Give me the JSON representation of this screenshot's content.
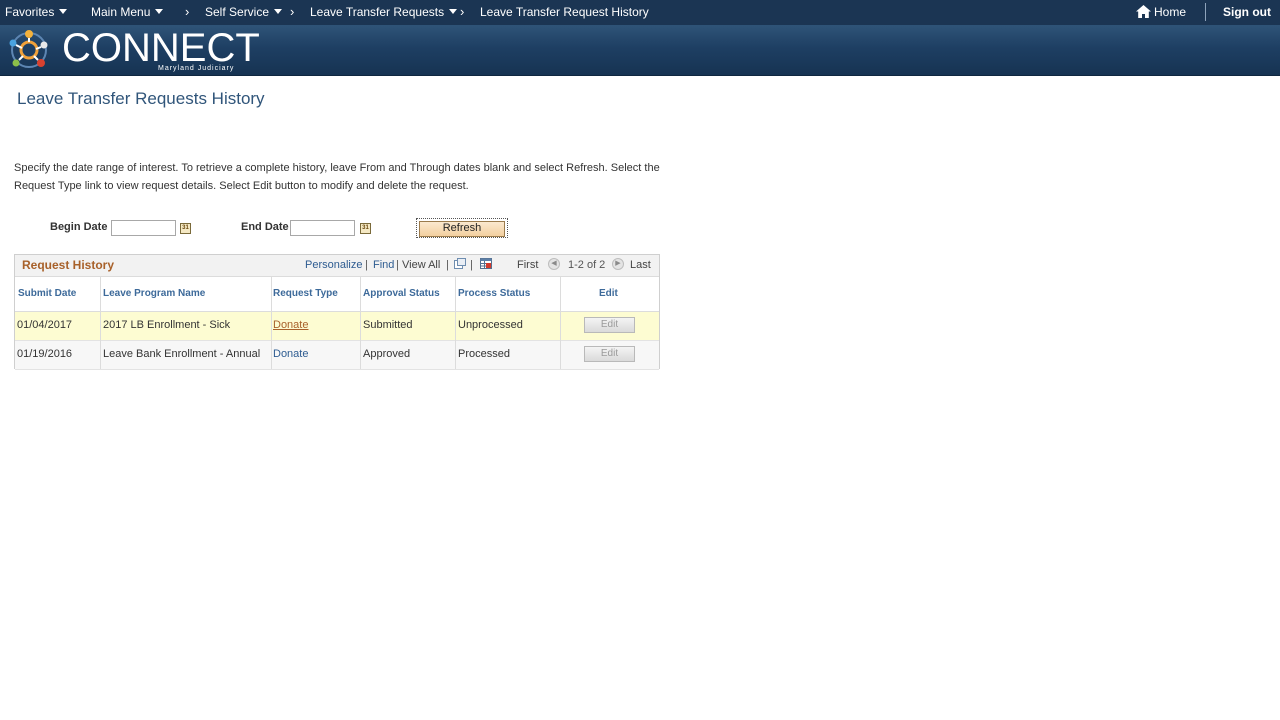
{
  "topnav": {
    "favorites": "Favorites",
    "main_menu": "Main Menu",
    "breadcrumb": [
      "Self Service",
      "Leave Transfer Requests",
      "Leave Transfer Request History"
    ],
    "home": "Home",
    "sign_out": "Sign out"
  },
  "banner": {
    "logo_text": "CONNECT",
    "logo_sub": "Maryland Judiciary"
  },
  "page": {
    "title": "Leave Transfer Requests History",
    "instructions_line1": "Specify the date range of interest. To retrieve a complete history, leave From and Through dates blank and select Refresh. Select the",
    "instructions_line2": "Request Type link to view request details. Select Edit button to modify and delete the request.",
    "begin_date_label": "Begin Date",
    "begin_date_value": "",
    "end_date_label": "End Date",
    "end_date_value": "",
    "calendar_icon_text": "31",
    "refresh_label": "Refresh"
  },
  "grid": {
    "title": "Request History",
    "personalize": "Personalize",
    "find": "Find",
    "view_all": "View All",
    "first": "First",
    "range": "1-2 of 2",
    "last": "Last",
    "columns": [
      "Submit Date",
      "Leave Program Name",
      "Request Type",
      "Approval Status",
      "Process Status",
      "Edit"
    ],
    "rows": [
      {
        "submit_date": "01/04/2017",
        "program": "2017 LB Enrollment - Sick",
        "request_type": "Donate",
        "approval_status": "Submitted",
        "process_status": "Unprocessed",
        "edit": "Edit"
      },
      {
        "submit_date": "01/19/2016",
        "program": "Leave Bank Enrollment - Annual",
        "request_type": "Donate",
        "approval_status": "Approved",
        "process_status": "Processed",
        "edit": "Edit"
      }
    ]
  },
  "colors": {
    "nav_bg": "#1b3553",
    "title_blue": "#30557a",
    "grid_title_orange": "#a8612a",
    "link_blue": "#2e5c91",
    "highlight_row": "#fdfcd2"
  }
}
